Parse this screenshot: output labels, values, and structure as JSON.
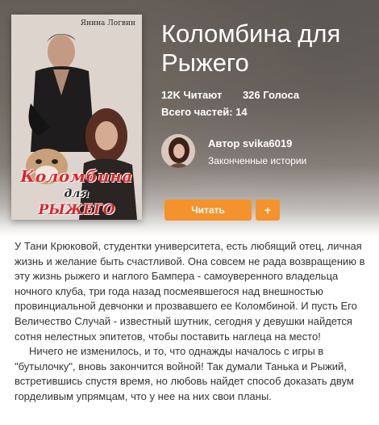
{
  "cover": {
    "author_line": "Янина Логвин",
    "title_line1": "Коломбина",
    "title_line2": "для",
    "title_line3": "РЫЖЕГО"
  },
  "book": {
    "title": "Коломбина для Рыжего",
    "reads": "12K Читают",
    "votes": "326 Голоса",
    "parts": "Всего частей: 14"
  },
  "author": {
    "name": "Автор svika6019",
    "status": "Законченные истории"
  },
  "actions": {
    "read_label": "Читать",
    "add_label": "+"
  },
  "description": {
    "paragraph1": "У Тани Крюковой, студентки университета, есть любящий отец, личная жизнь и желание быть счастливой. Она совсем не рада возвращению в эту жизнь рыжего и наглого Бампера - самоуверенного владельца ночного клуба, три года назад посмеявшегося над внешностью провинциальной девчонки и прозвавшего ее Коломбиной. И пусть Его Величество Случай - известный шутник, сегодня у девушки найдется сотня нелестных эпитетов, чтобы поставить наглеца на место!",
    "paragraph2": "Ничего не изменилось, и то, что однажды началось с игры в \"бутылочку\", вновь закончится войной! Так думали Танька и Рыжий, встретившись спустя время, но любовь найдет способ доказать двум горделивым упрямцам, что у нее на них свои планы."
  },
  "colors": {
    "accent": "#f6922b",
    "cover_title": "#d9262b"
  }
}
